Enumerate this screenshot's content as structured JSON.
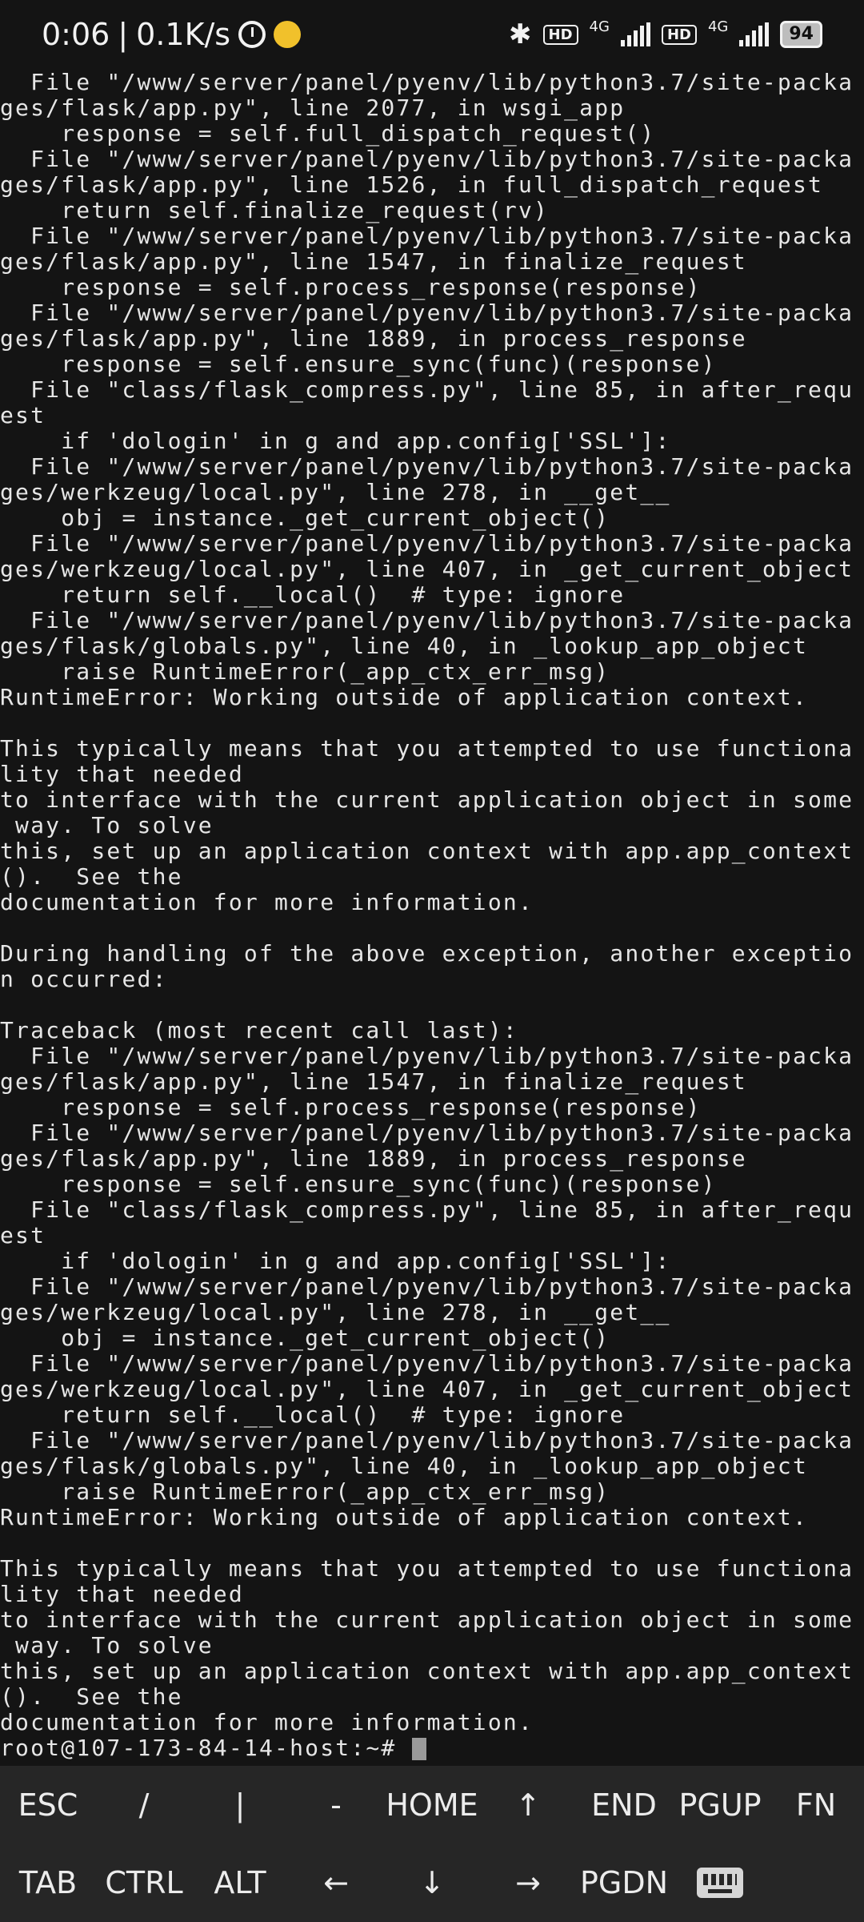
{
  "status_bar": {
    "time": "0:06",
    "separator": "|",
    "net_speed": "0.1K/s",
    "bluetooth_icon": "bluetooth-icon",
    "sim1_hd": "HD",
    "sim1_net": "4G",
    "sim2_hd": "HD",
    "sim2_net": "4G",
    "battery": "94"
  },
  "terminal": {
    "lines": [
      "  File \"/www/server/panel/pyenv/lib/python3.7/site-packa",
      "ges/flask/app.py\", line 2077, in wsgi_app",
      "    response = self.full_dispatch_request()",
      "  File \"/www/server/panel/pyenv/lib/python3.7/site-packa",
      "ges/flask/app.py\", line 1526, in full_dispatch_request",
      "    return self.finalize_request(rv)",
      "  File \"/www/server/panel/pyenv/lib/python3.7/site-packa",
      "ges/flask/app.py\", line 1547, in finalize_request",
      "    response = self.process_response(response)",
      "  File \"/www/server/panel/pyenv/lib/python3.7/site-packa",
      "ges/flask/app.py\", line 1889, in process_response",
      "    response = self.ensure_sync(func)(response)",
      "  File \"class/flask_compress.py\", line 85, in after_requ",
      "est",
      "    if 'dologin' in g and app.config['SSL']:",
      "  File \"/www/server/panel/pyenv/lib/python3.7/site-packa",
      "ges/werkzeug/local.py\", line 278, in __get__",
      "    obj = instance._get_current_object()",
      "  File \"/www/server/panel/pyenv/lib/python3.7/site-packa",
      "ges/werkzeug/local.py\", line 407, in _get_current_object",
      "    return self.__local()  # type: ignore",
      "  File \"/www/server/panel/pyenv/lib/python3.7/site-packa",
      "ges/flask/globals.py\", line 40, in _lookup_app_object",
      "    raise RuntimeError(_app_ctx_err_msg)",
      "RuntimeError: Working outside of application context.",
      "",
      "This typically means that you attempted to use functiona",
      "lity that needed",
      "to interface with the current application object in some",
      " way. To solve",
      "this, set up an application context with app.app_context",
      "().  See the",
      "documentation for more information.",
      "",
      "During handling of the above exception, another exceptio",
      "n occurred:",
      "",
      "Traceback (most recent call last):",
      "  File \"/www/server/panel/pyenv/lib/python3.7/site-packa",
      "ges/flask/app.py\", line 1547, in finalize_request",
      "    response = self.process_response(response)",
      "  File \"/www/server/panel/pyenv/lib/python3.7/site-packa",
      "ges/flask/app.py\", line 1889, in process_response",
      "    response = self.ensure_sync(func)(response)",
      "  File \"class/flask_compress.py\", line 85, in after_requ",
      "est",
      "    if 'dologin' in g and app.config['SSL']:",
      "  File \"/www/server/panel/pyenv/lib/python3.7/site-packa",
      "ges/werkzeug/local.py\", line 278, in __get__",
      "    obj = instance._get_current_object()",
      "  File \"/www/server/panel/pyenv/lib/python3.7/site-packa",
      "ges/werkzeug/local.py\", line 407, in _get_current_object",
      "    return self.__local()  # type: ignore",
      "  File \"/www/server/panel/pyenv/lib/python3.7/site-packa",
      "ges/flask/globals.py\", line 40, in _lookup_app_object",
      "    raise RuntimeError(_app_ctx_err_msg)",
      "RuntimeError: Working outside of application context.",
      "",
      "This typically means that you attempted to use functiona",
      "lity that needed",
      "to interface with the current application object in some",
      " way. To solve",
      "this, set up an application context with app.app_context",
      "().  See the",
      "documentation for more information."
    ],
    "prompt": "root@107-173-84-14-host:~# "
  },
  "extra_keys": {
    "row1": [
      "ESC",
      "/",
      "|",
      "-",
      "HOME",
      "↑",
      "END",
      "PGUP",
      "FN"
    ],
    "row2": [
      "TAB",
      "CTRL",
      "ALT",
      "←",
      "↓",
      "→",
      "PGDN"
    ],
    "keyboard_icon": "keyboard-icon"
  }
}
